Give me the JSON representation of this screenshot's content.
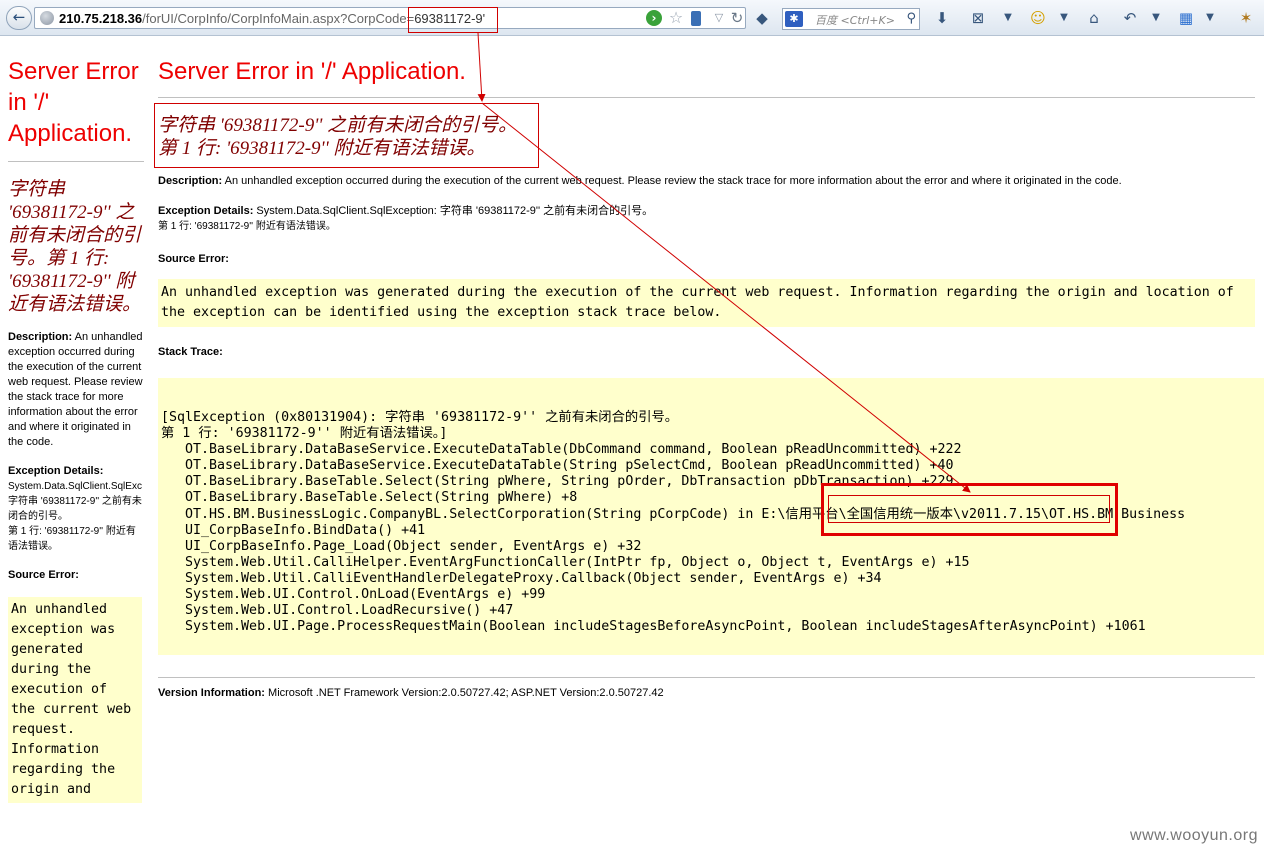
{
  "browser": {
    "url_host": "210.75.218.36",
    "url_path": "/forUI/CorpInfo/CorpInfoMain.aspx?CorpCode=",
    "url_param": "69381172-9'",
    "search_placeholder": "百度 <Ctrl+K>"
  },
  "page": {
    "title": "Server Error in '/' Application.",
    "error_line1": "字符串 '69381172-9'' 之前有未闭合的引号。",
    "error_line2": "第 1 行: '69381172-9'' 附近有语法错误。",
    "description_label": "Description:",
    "description_text": "An unhandled exception occurred during the execution of the current web request. Please review the stack trace for more information about the error and where it originated in the code.",
    "exception_label": "Exception Details:",
    "exception_text": "System.Data.SqlClient.SqlException: 字符串 '69381172-9'' 之前有未闭合的引号。",
    "exception_line2": "第 1 行: '69381172-9'' 附近有语法错误。",
    "source_error_label": "Source Error:",
    "source_error_text": "An unhandled exception was generated during the execution of the current web request. Information regarding the origin and location of the exception can be identified using the exception stack trace below.",
    "stack_trace_label": "Stack Trace:",
    "stack_lines": [
      "[SqlException (0x80131904): 字符串 '69381172-9'' 之前有未闭合的引号。",
      "第 1 行: '69381172-9'' 附近有语法错误。]",
      "   OT.BaseLibrary.DataBaseService.ExecuteDataTable(DbCommand command, Boolean pReadUncommitted) +222",
      "   OT.BaseLibrary.DataBaseService.ExecuteDataTable(String pSelectCmd, Boolean pReadUncommitted) +40",
      "   OT.BaseLibrary.BaseTable.Select(String pWhere, String pOrder, DbTransaction pDbTransaction) +229",
      "   OT.BaseLibrary.BaseTable.Select(String pWhere) +8",
      "   OT.HS.BM.BusinessLogic.CompanyBL.SelectCorporation(String pCorpCode) in E:\\信用平台\\全国信用统一版本\\v2011.7.15\\OT.HS.BM.Business",
      "   UI_CorpBaseInfo.BindData() +41",
      "   UI_CorpBaseInfo.Page_Load(Object sender, EventArgs e) +32",
      "   System.Web.Util.CalliHelper.EventArgFunctionCaller(IntPtr fp, Object o, Object t, EventArgs e) +15",
      "   System.Web.Util.CalliEventHandlerDelegateProxy.Callback(Object sender, EventArgs e) +34",
      "   System.Web.UI.Control.OnLoad(EventArgs e) +99",
      "   System.Web.UI.Control.LoadRecursive() +47",
      "   System.Web.UI.Page.ProcessRequestMain(Boolean includeStagesBeforeAsyncPoint, Boolean includeStagesAfterAsyncPoint) +1061"
    ],
    "version_label": "Version Information:",
    "version_text": "Microsoft .NET Framework Version:2.0.50727.42; ASP.NET Version:2.0.50727.42"
  },
  "left_pane": {
    "title": "Server Error in '/' Application.",
    "error_text": "字符串 '69381172-9'' 之前有未闭合的引号。第 1 行: '69381172-9'' 附近有语法错误。",
    "description_text": "An unhandled exception occurred during the execution of the current web request. Please review the stack trace for more information about the error and where it originated in the code.",
    "exception_text": "System.Data.SqlClient.SqlExc",
    "exception_line2": "字符串 '69381172-9'' 之前有未闭合的引号。",
    "exception_line3": "第 1 行: '69381172-9'' 附近有语法错误。",
    "source_error_text": "An unhandled exception was generated during the execution of the current web request. Information regarding the origin and"
  },
  "watermark": "www.wooyun.org",
  "colors": {
    "error_red": "#ee0000",
    "maroon": "#800000",
    "code_bg": "#ffffcc",
    "annotation_red": "#e00000"
  }
}
